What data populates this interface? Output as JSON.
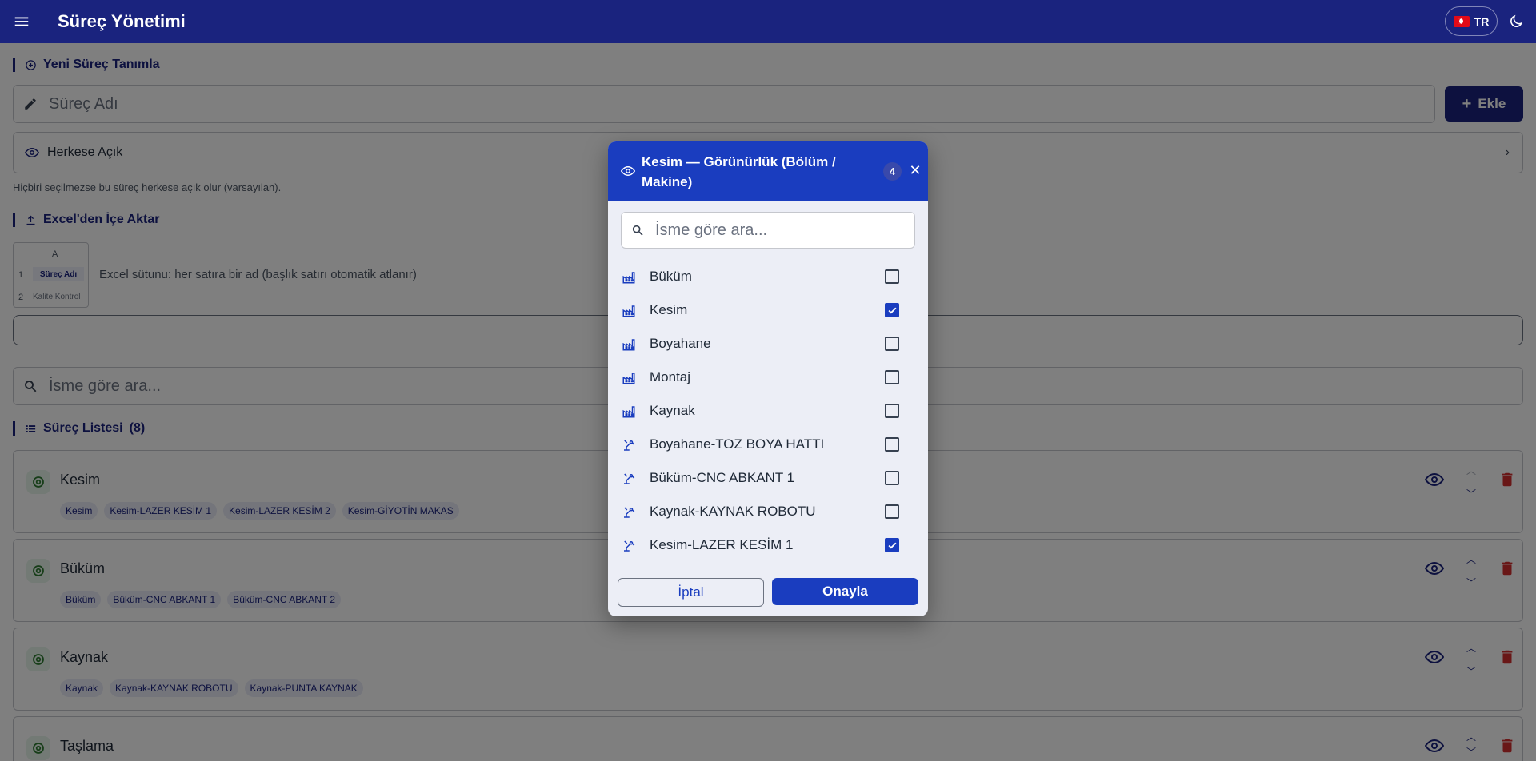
{
  "app": {
    "title": "Süreç Yönetimi",
    "language": "TR"
  },
  "new_process": {
    "heading": "Yeni Süreç Tanımla",
    "name_placeholder": "Süreç Adı",
    "add_label": "Ekle",
    "visibility_label": "Herkese Açık",
    "visibility_hint": "Hiçbiri seçilmezse bu süreç herkese açık olur (varsayılan)."
  },
  "excel_import": {
    "heading": "Excel'den İçe Aktar",
    "column_header": "A",
    "row1_num": "1",
    "row1_value": "Süreç Adı",
    "row2_num": "2",
    "row2_value": "Kalite Kontrol",
    "description": "Excel sütunu: her satıra bir ad (başlık satırı otomatik atlanır)"
  },
  "search": {
    "placeholder": "İsme göre ara..."
  },
  "process_list": {
    "heading": "Süreç Listesi",
    "count": "(8)",
    "items": [
      {
        "name": "Kesim",
        "chips": [
          "Kesim",
          "Kesim-LAZER KESİM 1",
          "Kesim-LAZER KESİM 2",
          "Kesim-GİYOTİN MAKAS"
        ]
      },
      {
        "name": "Büküm",
        "chips": [
          "Büküm",
          "Büküm-CNC ABKANT 1",
          "Büküm-CNC ABKANT 2"
        ]
      },
      {
        "name": "Kaynak",
        "chips": [
          "Kaynak",
          "Kaynak-KAYNAK ROBOTU",
          "Kaynak-PUNTA KAYNAK"
        ]
      },
      {
        "name": "Taşlama",
        "chips": []
      }
    ]
  },
  "dialog": {
    "title": "Kesim — Görünürlük (Bölüm / Makine)",
    "selected_count": "4",
    "search_placeholder": "İsme göre ara...",
    "options": [
      {
        "label": "Büküm",
        "type": "department-icon",
        "checked": false
      },
      {
        "label": "Kesim",
        "type": "department-icon",
        "checked": true
      },
      {
        "label": "Boyahane",
        "type": "department-icon",
        "checked": false
      },
      {
        "label": "Montaj",
        "type": "department-icon",
        "checked": false
      },
      {
        "label": "Kaynak",
        "type": "department-icon",
        "checked": false
      },
      {
        "label": "Boyahane-TOZ BOYA HATTI",
        "type": "machine-icon",
        "checked": false
      },
      {
        "label": "Büküm-CNC ABKANT 1",
        "type": "machine-icon",
        "checked": false
      },
      {
        "label": "Kaynak-KAYNAK ROBOTU",
        "type": "machine-icon",
        "checked": false
      },
      {
        "label": "Kesim-LAZER KESİM 1",
        "type": "machine-icon",
        "checked": true
      }
    ],
    "cancel_label": "İptal",
    "confirm_label": "Onayla"
  },
  "colors": {
    "primary": "#1a237e",
    "dialog_accent": "#1a3dbf",
    "danger": "#d32f2f",
    "success": "#2e7d32"
  }
}
